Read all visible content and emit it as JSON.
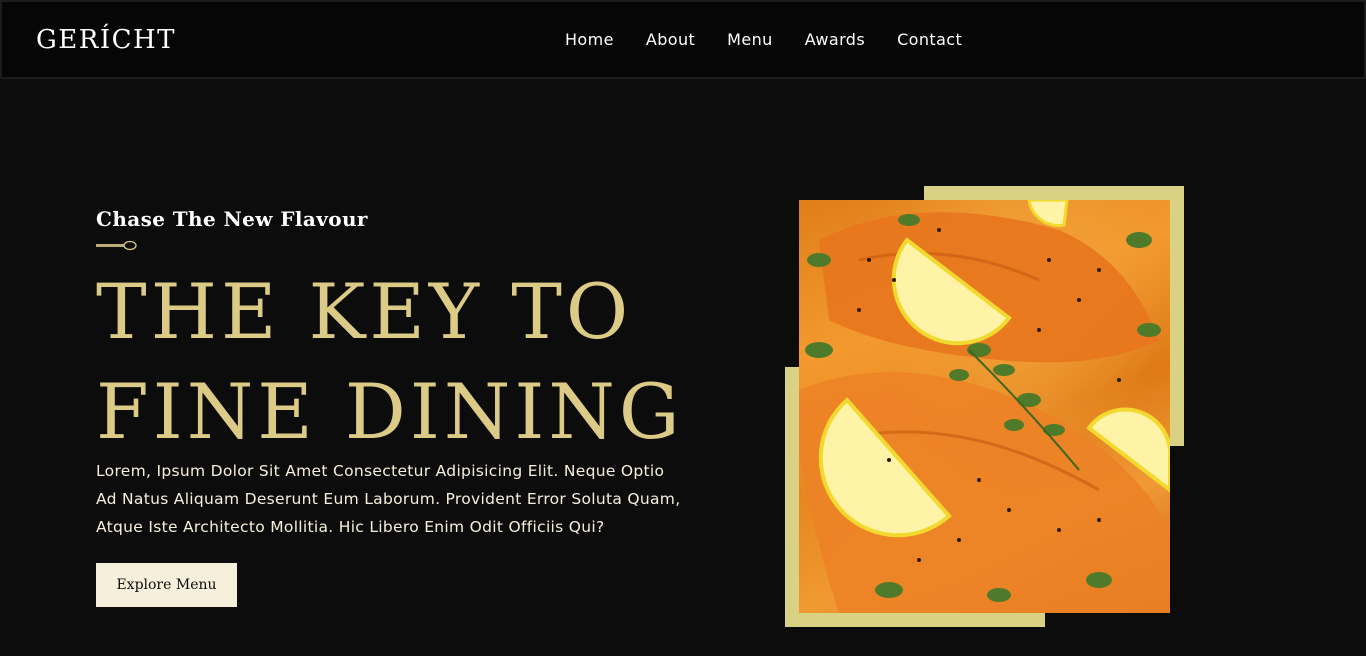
{
  "navbar": {
    "logo": "GERÍCHT",
    "links": [
      "Home",
      "About",
      "Menu",
      "Awards",
      "Contact"
    ]
  },
  "hero": {
    "subtitle": "Chase The New Flavour",
    "headline_line1": "THE KEY TO",
    "headline_line2": "FINE DINING",
    "description": "Lorem, Ipsum Dolor Sit Amet Consectetur Adipisicing Elit. Neque Optio Ad Natus Aliquam Deserunt Eum Laborum. Provident Error Soluta Quam, Atque Iste Architecto Mollitia. Hic Libero Enim Odit Officiis Qui?",
    "button_label": "Explore Menu",
    "icon": "spoon-icon",
    "image": "salmon-dish-photo"
  },
  "colors": {
    "background": "#0c0c0c",
    "golden": "#dcca87",
    "frame": "#d9d183",
    "crimson": "#f5efdb"
  }
}
